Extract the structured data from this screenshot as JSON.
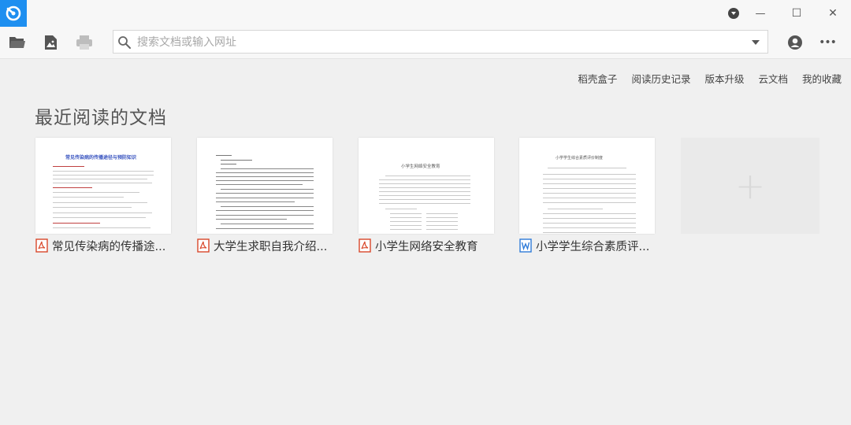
{
  "window": {
    "minimize_glyph": "—",
    "maximize_glyph": "☐",
    "close_glyph": "✕"
  },
  "toolbar": {
    "open_icon": "folder-icon",
    "image_icon": "image-icon",
    "print_icon": "printer-icon",
    "account_icon": "user-icon",
    "more_label": "•••"
  },
  "search": {
    "placeholder": "搜索文档或输入网址",
    "value": ""
  },
  "top_links": [
    {
      "label": "稻壳盒子"
    },
    {
      "label": "阅读历史记录"
    },
    {
      "label": "版本升级"
    },
    {
      "label": "云文档"
    },
    {
      "label": "我的收藏"
    }
  ],
  "section": {
    "title": "最近阅读的文档"
  },
  "documents": [
    {
      "name": "常见传染病的传播途...",
      "type": "pdf",
      "thumb_title": "常见传染病的传播途径与预防知识"
    },
    {
      "name": "大学生求职自我介绍...",
      "type": "pdf",
      "thumb_title": ""
    },
    {
      "name": "小学生网络安全教育",
      "type": "pdf",
      "thumb_title": "小学生网络安全教育"
    },
    {
      "name": "小学学生综合素质评...",
      "type": "word",
      "thumb_title": "小学学生综合素质评价制度"
    }
  ],
  "add_card": {
    "glyph": "+"
  }
}
